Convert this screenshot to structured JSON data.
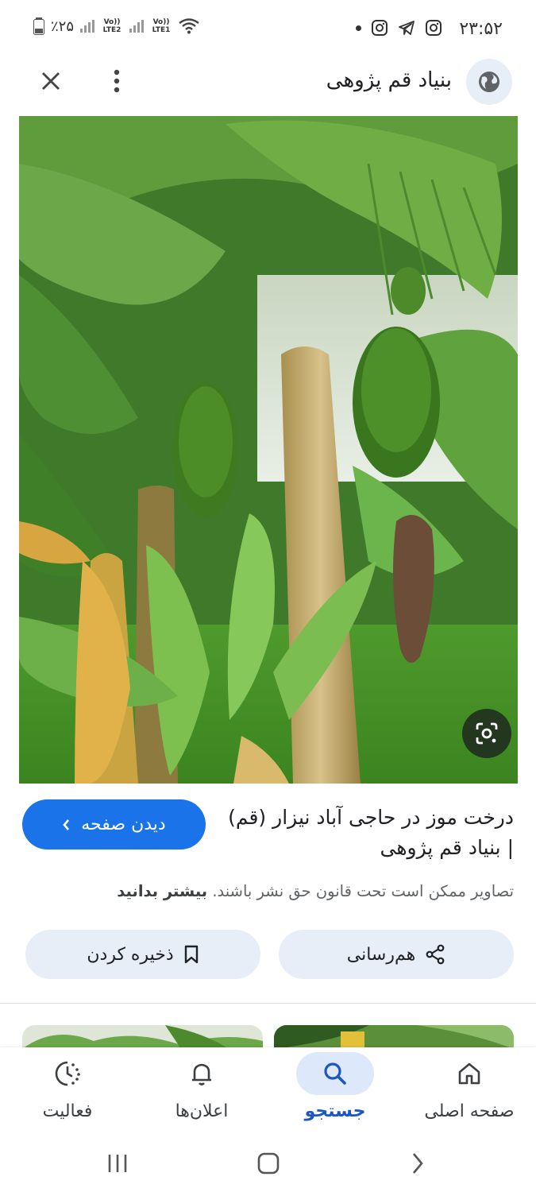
{
  "status_bar": {
    "time": "۲۳:۵۲",
    "battery": "٪۲۵",
    "sim1_label": "Vo)) LTE2",
    "sim2_label": "Vo)) LTE1"
  },
  "header": {
    "site_title": "بنیاد قم پژوهی"
  },
  "result": {
    "caption": "درخت موز در حاجی آباد نیزار (قم) | بنیاد قم پژوهی",
    "visit_label": "دیدن صفحه",
    "copyright_text": "تصاویر ممکن است تحت قانون حق نشر باشند.",
    "learn_more": "بیشتر بدانید",
    "share_label": "هم‌رسانی",
    "save_label": "ذخیره کردن"
  },
  "bottom_nav": {
    "items": [
      {
        "label": "صفحه اصلی",
        "icon": "home-icon"
      },
      {
        "label": "جستجو",
        "icon": "search-icon",
        "active": true
      },
      {
        "label": "اعلان‌ها",
        "icon": "bell-icon"
      },
      {
        "label": "فعالیت",
        "icon": "activity-icon"
      }
    ]
  },
  "colors": {
    "accent": "#1a73e8",
    "active_nav_bg": "#dde8fb",
    "pill_bg": "#e8eef8"
  }
}
